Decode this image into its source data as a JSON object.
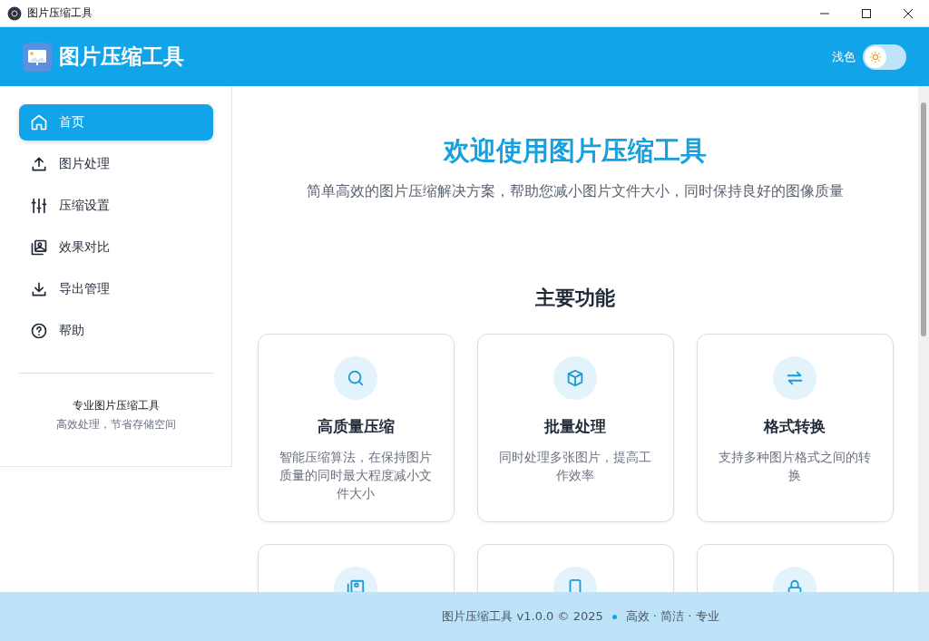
{
  "window": {
    "title": "图片压缩工具"
  },
  "header": {
    "title": "图片压缩工具",
    "theme_label": "浅色",
    "theme_toggle_on": false
  },
  "sidebar": {
    "items": [
      {
        "label": "首页",
        "selected": true
      },
      {
        "label": "图片处理",
        "selected": false
      },
      {
        "label": "压缩设置",
        "selected": false
      },
      {
        "label": "效果对比",
        "selected": false
      },
      {
        "label": "导出管理",
        "selected": false
      },
      {
        "label": "帮助",
        "selected": false
      }
    ],
    "footer_title": "专业图片压缩工具",
    "footer_subtitle": "高效处理，节省存储空间"
  },
  "main": {
    "title": "欢迎使用图片压缩工具",
    "subtitle": "简单高效的图片压缩解决方案，帮助您减小图片文件大小，同时保持良好的图像质量",
    "section_title": "主要功能",
    "features": [
      {
        "kind": "full",
        "title": "高质量压缩",
        "description": "智能压缩算法，在保持图片质量的同时最大程度减小文件大小"
      },
      {
        "kind": "full",
        "title": "批量处理",
        "description": "同时处理多张图片，提高工作效率"
      },
      {
        "kind": "full",
        "title": "格式转换",
        "description": "支持多种图片格式之间的转换"
      },
      {
        "kind": "clipped"
      },
      {
        "kind": "clipped"
      },
      {
        "kind": "clipped"
      }
    ]
  },
  "status_bar": {
    "text": "图片压缩工具 v1.0.0 © 2025",
    "tagline": "高效 · 简洁 · 专业"
  }
}
